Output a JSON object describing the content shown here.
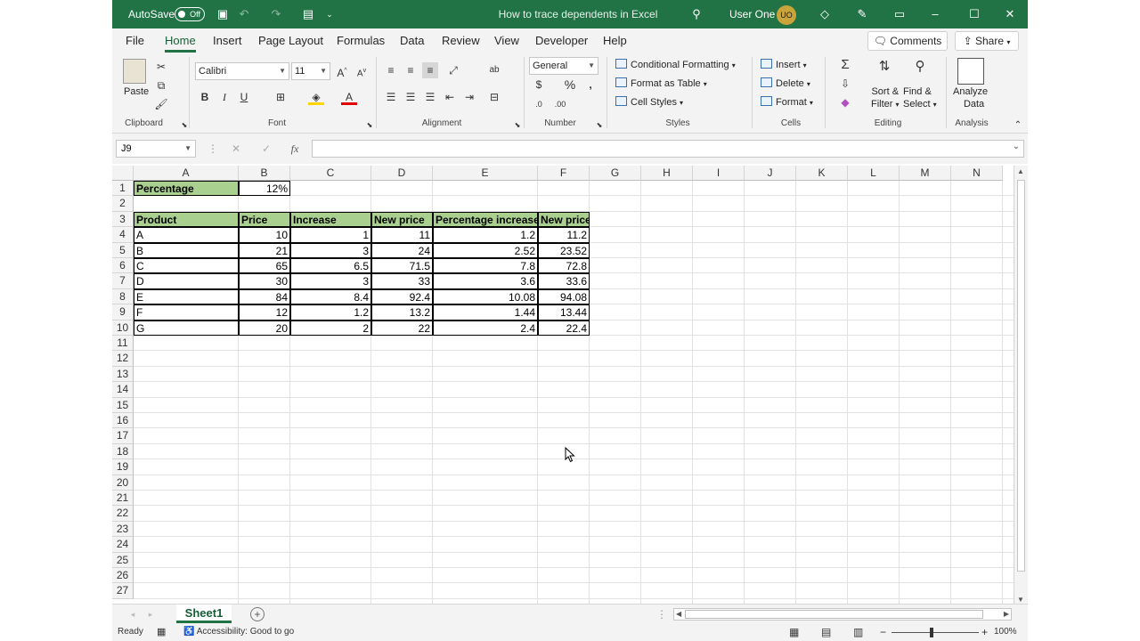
{
  "titlebar": {
    "autosave_label": "AutoSave",
    "autosave_state": "Off",
    "doc_title": "How to trace dependents in Excel",
    "user_name": "User One",
    "user_initials": "UO",
    "brand_color": "#217346"
  },
  "menu_tabs": [
    "File",
    "Home",
    "Insert",
    "Page Layout",
    "Formulas",
    "Data",
    "Review",
    "View",
    "Developer",
    "Help"
  ],
  "active_tab": "Home",
  "actions": {
    "comments": "Comments",
    "share": "Share"
  },
  "ribbon": {
    "clipboard": {
      "paste": "Paste",
      "label": "Clipboard"
    },
    "font": {
      "name": "Calibri",
      "size": "11",
      "bold": "B",
      "italic": "I",
      "underline": "U",
      "label": "Font"
    },
    "alignment": {
      "label": "Alignment"
    },
    "number": {
      "format": "General",
      "percent": "%",
      "label": "Number"
    },
    "styles": {
      "conditional": "Conditional Formatting",
      "format_table": "Format as Table",
      "cell_styles": "Cell Styles",
      "label": "Styles"
    },
    "cells": {
      "insert": "Insert",
      "delete": "Delete",
      "format": "Format",
      "label": "Cells"
    },
    "editing": {
      "sort_filter_1": "Sort &",
      "sort_filter_2": "Filter",
      "find_select_1": "Find &",
      "find_select_2": "Select",
      "label": "Editing"
    },
    "analysis": {
      "analyze_1": "Analyze",
      "analyze_2": "Data",
      "label": "Analysis"
    }
  },
  "formula_bar": {
    "name_box": "J9",
    "fx": "fx",
    "value": ""
  },
  "columns": [
    "A",
    "B",
    "C",
    "D",
    "E",
    "F",
    "G",
    "H",
    "I",
    "J",
    "K",
    "L",
    "M",
    "N"
  ],
  "rows": [
    "1",
    "2",
    "3",
    "4",
    "5",
    "6",
    "7",
    "8",
    "9",
    "10",
    "11",
    "12",
    "13",
    "14",
    "15",
    "16",
    "17",
    "18",
    "19",
    "20",
    "21",
    "22",
    "23",
    "24",
    "25",
    "26",
    "27"
  ],
  "sheet": {
    "percentage_label": "Percentage",
    "percentage_value": "12%",
    "headers": [
      "Product",
      "Price",
      "Increase",
      "New price",
      "Percentage increase",
      "New price"
    ],
    "table": [
      [
        "A",
        "10",
        "1",
        "11",
        "1.2",
        "11.2"
      ],
      [
        "B",
        "21",
        "3",
        "24",
        "2.52",
        "23.52"
      ],
      [
        "C",
        "65",
        "6.5",
        "71.5",
        "7.8",
        "72.8"
      ],
      [
        "D",
        "30",
        "3",
        "33",
        "3.6",
        "33.6"
      ],
      [
        "E",
        "84",
        "8.4",
        "92.4",
        "10.08",
        "94.08"
      ],
      [
        "F",
        "12",
        "1.2",
        "13.2",
        "1.44",
        "13.44"
      ],
      [
        "G",
        "20",
        "2",
        "22",
        "2.4",
        "22.4"
      ]
    ],
    "header_fill": "#a9d08e"
  },
  "sheet_tabs": {
    "active": "Sheet1"
  },
  "statusbar": {
    "ready": "Ready",
    "accessibility": "Accessibility: Good to go",
    "zoom": "100%"
  }
}
